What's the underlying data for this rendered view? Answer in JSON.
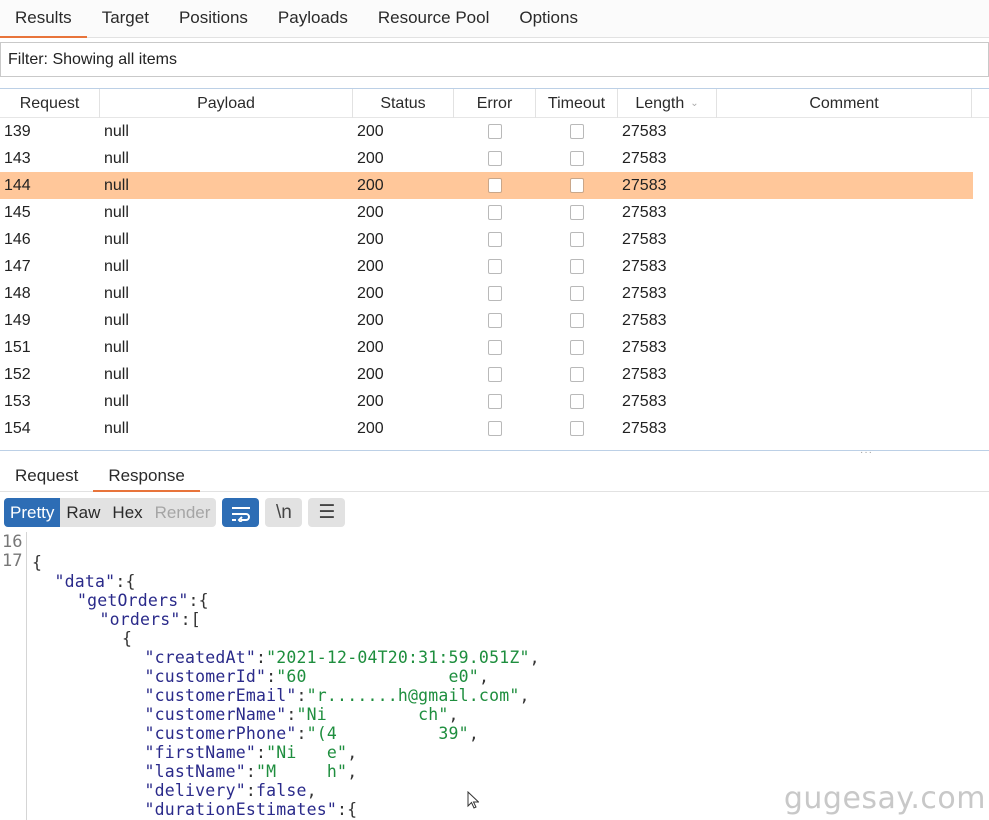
{
  "top_tabs": [
    {
      "label": "Results",
      "active": true
    },
    {
      "label": "Target",
      "active": false
    },
    {
      "label": "Positions",
      "active": false
    },
    {
      "label": "Payloads",
      "active": false
    },
    {
      "label": "Resource Pool",
      "active": false
    },
    {
      "label": "Options",
      "active": false
    }
  ],
  "filter": {
    "label": "Filter: Showing all items"
  },
  "table": {
    "columns": [
      "Request",
      "Payload",
      "Status",
      "Error",
      "Timeout",
      "Length",
      "Comment"
    ],
    "sorted_column": "Length",
    "rows": [
      {
        "request": "139",
        "payload": "null",
        "status": "200",
        "error": false,
        "timeout": false,
        "length": "27583",
        "comment": "",
        "selected": false
      },
      {
        "request": "143",
        "payload": "null",
        "status": "200",
        "error": false,
        "timeout": false,
        "length": "27583",
        "comment": "",
        "selected": false
      },
      {
        "request": "144",
        "payload": "null",
        "status": "200",
        "error": false,
        "timeout": false,
        "length": "27583",
        "comment": "",
        "selected": true
      },
      {
        "request": "145",
        "payload": "null",
        "status": "200",
        "error": false,
        "timeout": false,
        "length": "27583",
        "comment": "",
        "selected": false
      },
      {
        "request": "146",
        "payload": "null",
        "status": "200",
        "error": false,
        "timeout": false,
        "length": "27583",
        "comment": "",
        "selected": false
      },
      {
        "request": "147",
        "payload": "null",
        "status": "200",
        "error": false,
        "timeout": false,
        "length": "27583",
        "comment": "",
        "selected": false
      },
      {
        "request": "148",
        "payload": "null",
        "status": "200",
        "error": false,
        "timeout": false,
        "length": "27583",
        "comment": "",
        "selected": false
      },
      {
        "request": "149",
        "payload": "null",
        "status": "200",
        "error": false,
        "timeout": false,
        "length": "27583",
        "comment": "",
        "selected": false
      },
      {
        "request": "151",
        "payload": "null",
        "status": "200",
        "error": false,
        "timeout": false,
        "length": "27583",
        "comment": "",
        "selected": false
      },
      {
        "request": "152",
        "payload": "null",
        "status": "200",
        "error": false,
        "timeout": false,
        "length": "27583",
        "comment": "",
        "selected": false
      },
      {
        "request": "153",
        "payload": "null",
        "status": "200",
        "error": false,
        "timeout": false,
        "length": "27583",
        "comment": "",
        "selected": false
      },
      {
        "request": "154",
        "payload": "null",
        "status": "200",
        "error": false,
        "timeout": false,
        "length": "27583",
        "comment": "",
        "selected": false
      }
    ],
    "splitter_handle": "···"
  },
  "sub_tabs": [
    {
      "label": "Request",
      "active": false
    },
    {
      "label": "Response",
      "active": true
    }
  ],
  "view_modes": [
    {
      "label": "Pretty",
      "state": "active"
    },
    {
      "label": "Raw",
      "state": "normal"
    },
    {
      "label": "Hex",
      "state": "normal"
    },
    {
      "label": "Render",
      "state": "disabled"
    }
  ],
  "tool_icons": {
    "wrap": "↩",
    "newline": "\\n",
    "menu": "☰"
  },
  "editor": {
    "line_numbers": [
      "16",
      "17"
    ],
    "lines": [
      {
        "indent": 0,
        "key": "",
        "sep": "{",
        "value": "",
        "tail": ""
      },
      {
        "indent": 1,
        "key": "\"data\"",
        "sep": ":{",
        "value": "",
        "tail": ""
      },
      {
        "indent": 2,
        "key": "\"getOrders\"",
        "sep": ":{",
        "value": "",
        "tail": ""
      },
      {
        "indent": 3,
        "key": "\"orders\"",
        "sep": ":[",
        "value": "",
        "tail": ""
      },
      {
        "indent": 4,
        "key": "",
        "sep": "{",
        "value": "",
        "tail": ""
      },
      {
        "indent": 5,
        "key": "\"createdAt\"",
        "sep": ":",
        "value": "\"2021-12-04T20:31:59.051Z\"",
        "tail": ","
      },
      {
        "indent": 5,
        "key": "\"customerId\"",
        "sep": ":",
        "value": "\"60              e0\"",
        "tail": ","
      },
      {
        "indent": 5,
        "key": "\"customerEmail\"",
        "sep": ":",
        "value": "\"r.......h@gmail.com\"",
        "tail": ","
      },
      {
        "indent": 5,
        "key": "\"customerName\"",
        "sep": ":",
        "value": "\"Ni         ch\"",
        "tail": ","
      },
      {
        "indent": 5,
        "key": "\"customerPhone\"",
        "sep": ":",
        "value": "\"(4          39\"",
        "tail": ","
      },
      {
        "indent": 5,
        "key": "\"firstName\"",
        "sep": ":",
        "value": "\"Ni   e\"",
        "tail": ","
      },
      {
        "indent": 5,
        "key": "\"lastName\"",
        "sep": ":",
        "value": "\"M     h\"",
        "tail": ","
      },
      {
        "indent": 5,
        "key": "\"delivery\"",
        "sep": ":",
        "value": "false",
        "tail": ","
      },
      {
        "indent": 5,
        "key": "\"durationEstimates\"",
        "sep": ":{",
        "value": "",
        "tail": ""
      }
    ]
  },
  "watermark": "gugesay.com"
}
